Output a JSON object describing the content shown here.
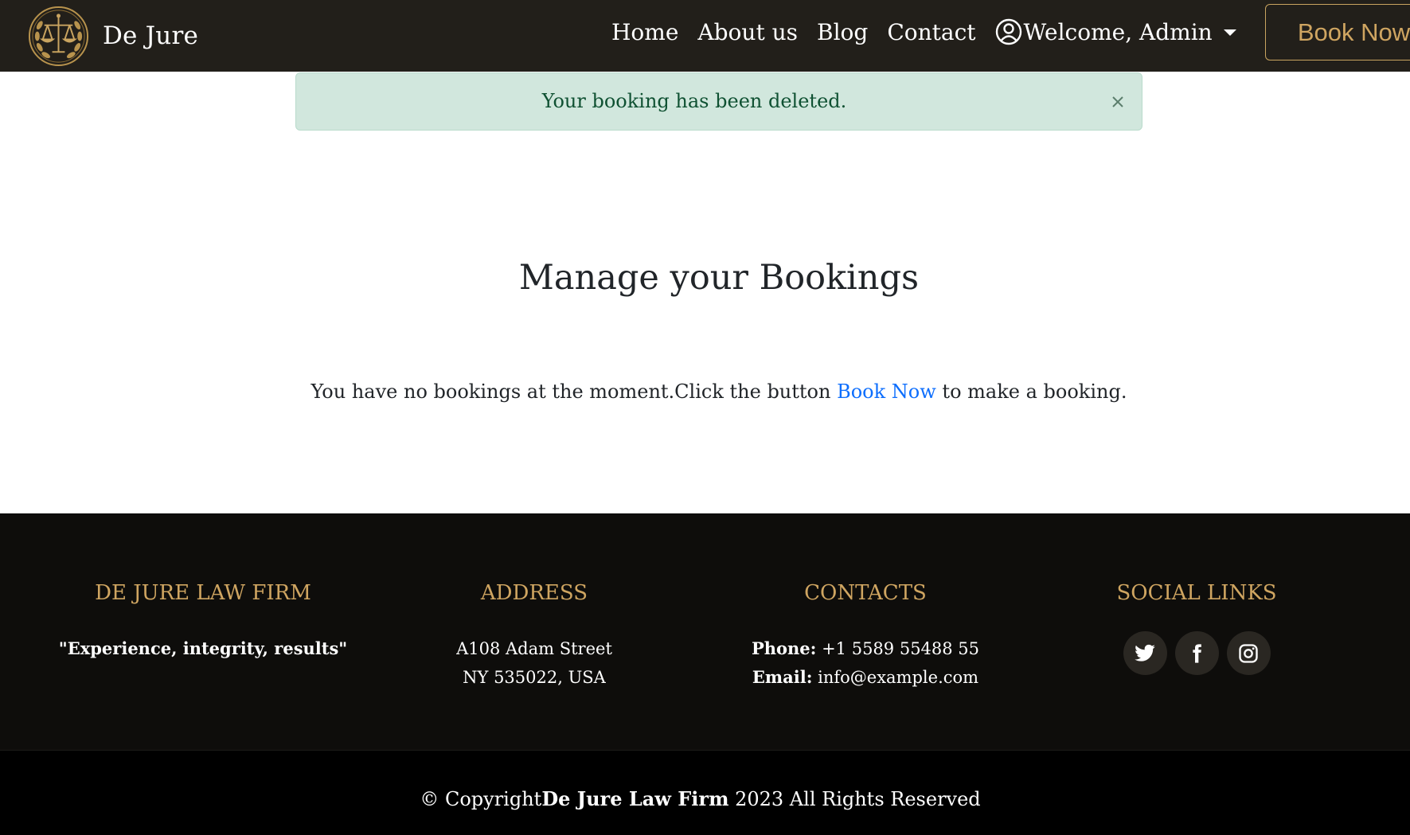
{
  "header": {
    "brand": "De Jure",
    "nav": [
      "Home",
      "About us",
      "Blog",
      "Contact"
    ],
    "user_label": "Welcome, Admin",
    "book_button": "Book Now"
  },
  "alert": {
    "message": "Your booking has been deleted."
  },
  "main": {
    "title": "Manage your Bookings",
    "empty_prefix": "You have no bookings at the moment.Click the button ",
    "empty_link": "Book Now",
    "empty_suffix": " to make a booking."
  },
  "footer": {
    "firm": {
      "heading": "DE JURE LAW FIRM",
      "tagline": "\"Experience, integrity, results\""
    },
    "address": {
      "heading": "ADDRESS",
      "line1": "A108 Adam Street",
      "line2": "NY 535022, USA"
    },
    "contacts": {
      "heading": "CONTACTS",
      "phone_label": "Phone:",
      "phone": " +1 5589 55488 55",
      "email_label": "Email:",
      "email": " info@example.com"
    },
    "social": {
      "heading": "SOCIAL LINKS",
      "icons": [
        "twitter-icon",
        "facebook-icon",
        "instagram-icon"
      ]
    },
    "copyright": {
      "prefix": "© Copyright",
      "firm": "De Jure Law Firm",
      "suffix": " 2023 All Rights Reserved"
    }
  },
  "colors": {
    "navbar_bg": "#221f1a",
    "accent_gold": "#cfa561",
    "alert_bg": "#d1e7dd",
    "alert_text": "#0f5132",
    "link_blue": "#0d6efd",
    "footer_bg": "#0e0d0b",
    "footer_bottom_bg": "#000000"
  }
}
